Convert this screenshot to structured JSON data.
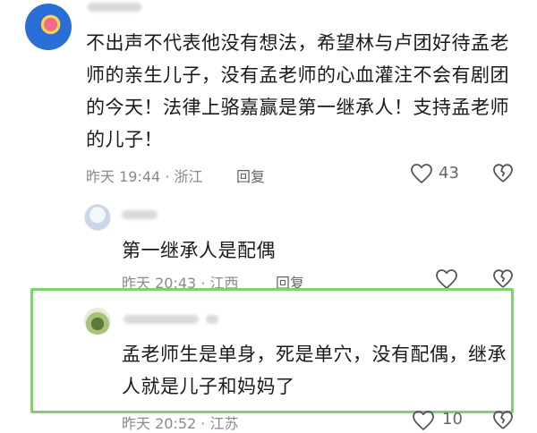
{
  "main_comment": {
    "text": "不出声不代表他没有想法，希望林与卢团好待孟老师的亲生儿子，没有孟老师的心血灌注不会有剧团的今天！法律上骆嘉赢是第一继承人！支持孟老师的儿子！",
    "meta": "昨天 19:44 · 浙江",
    "reply_label": "回复",
    "likes": "43"
  },
  "reply1": {
    "text": "第一继承人是配偶",
    "meta": "昨天 20:43 · 江西",
    "reply_label": "回复"
  },
  "reply2": {
    "text": "孟老师生是单身，死是单穴，没有配偶，继承人就是儿子和妈妈了",
    "meta": "昨天 20:52 · 江苏",
    "likes": "10"
  },
  "colors": {
    "highlight_border": "#7ed36f",
    "meta_gray": "#8a8a8a"
  },
  "icons": [
    "heart-outline-icon",
    "broken-heart-icon"
  ]
}
